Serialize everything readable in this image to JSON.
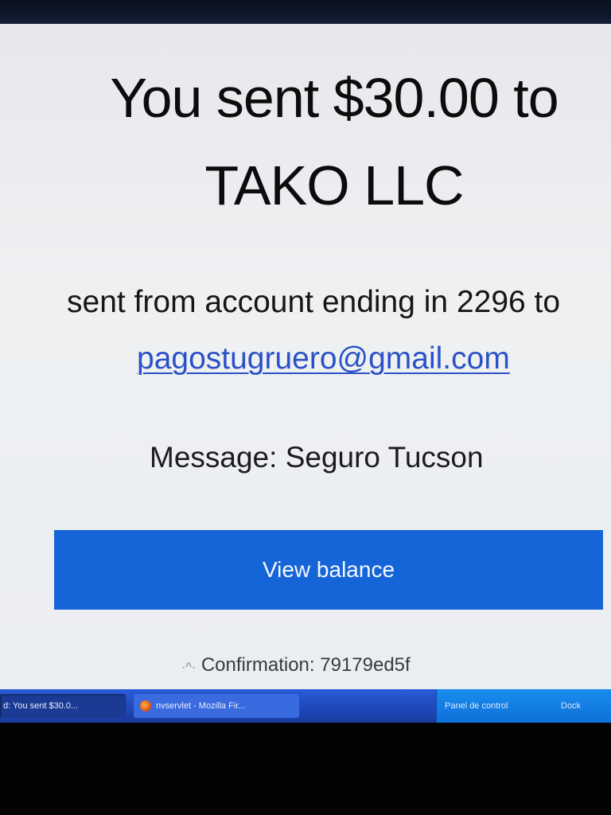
{
  "payment": {
    "headline_line1": "You sent $30.00 to",
    "headline_line2": "TAKO LLC",
    "sent_from": "sent from account ending in 2296 to",
    "recipient_email": "pagostugruero@gmail.com",
    "message_label": "Message:",
    "message_value": "Seguro Tucson",
    "view_balance_label": "View balance",
    "confirmation_label": "Confirmation:",
    "confirmation_code": "79179ed5f"
  },
  "taskbar": {
    "active_task": "d: You sent $30.0...",
    "firefox_task": "nvservlet - Mozilla Fir...",
    "tray_control_panel": "Panel de control",
    "tray_extra": "Dock"
  },
  "colors": {
    "button_blue": "#1565d8",
    "link_blue": "#2a52c8",
    "taskbar_blue": "#2a5bd8"
  }
}
